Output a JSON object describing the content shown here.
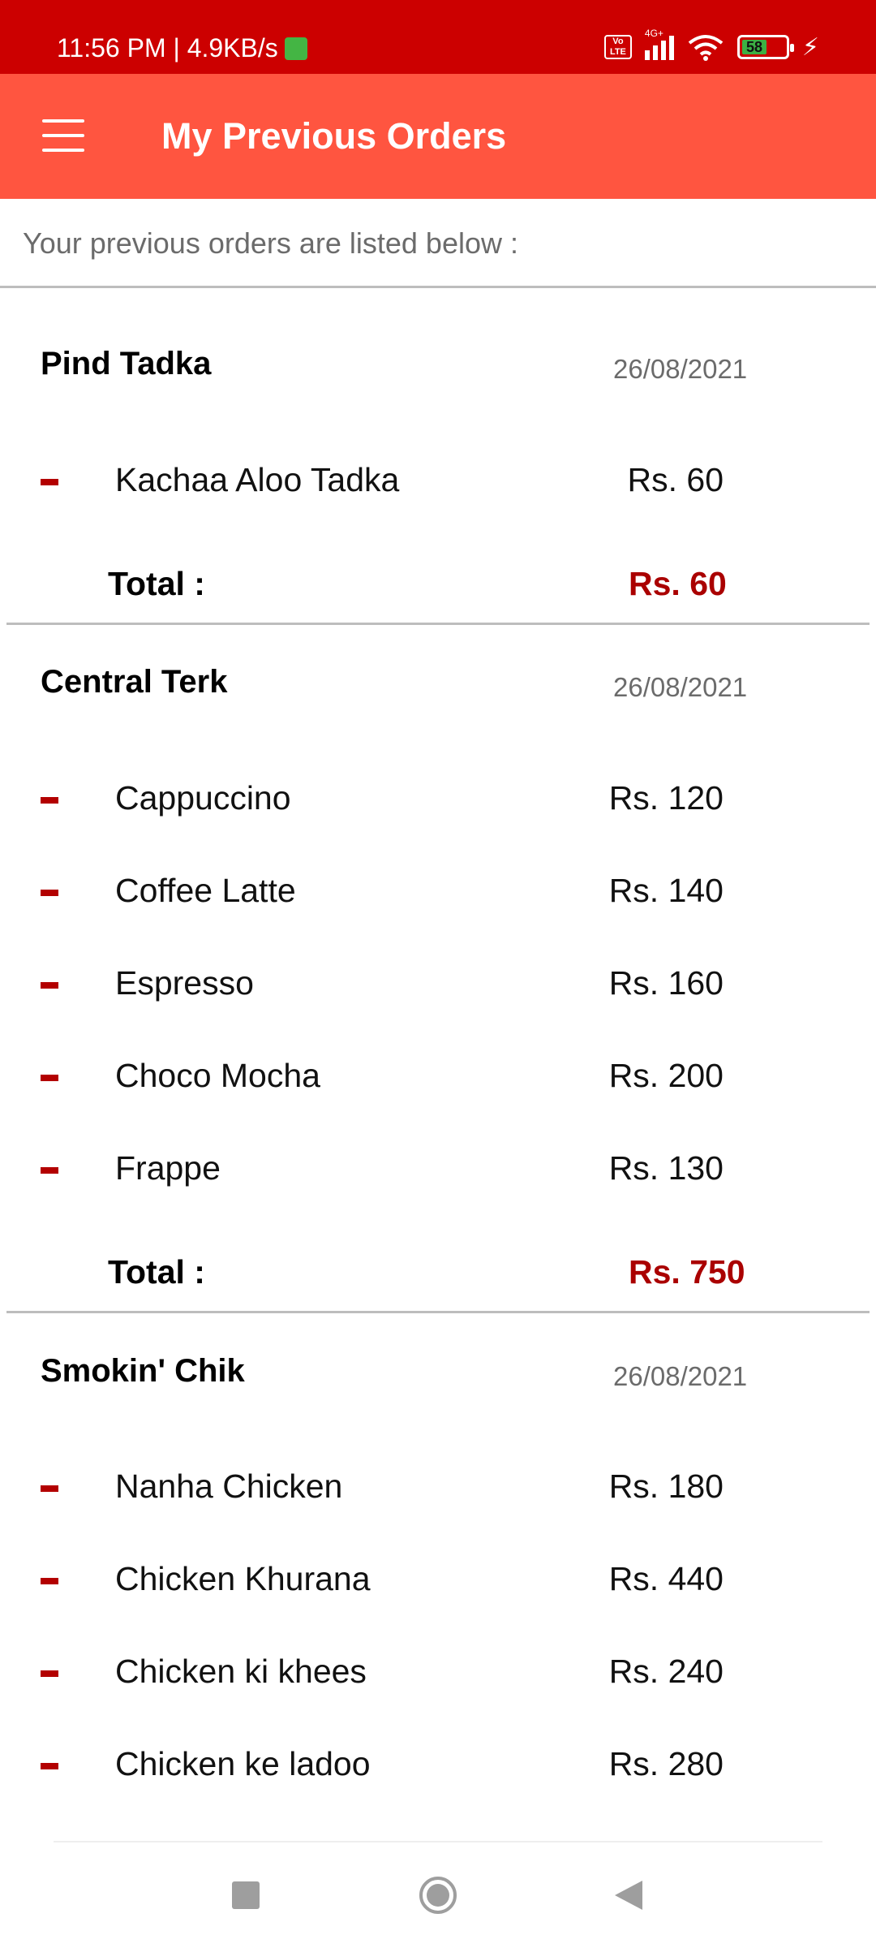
{
  "status_bar": {
    "time": "11:56 PM | 4.9KB/s",
    "volte": "Vo LTE",
    "network": "4G+",
    "battery": "58"
  },
  "app_bar": {
    "title": "My Previous Orders",
    "menu_icon": "hamburger-menu-icon"
  },
  "intro_text": "Your previous orders are listed below :",
  "orders": [
    {
      "restaurant": "Pind Tadka",
      "date": "26/08/2021",
      "items": [
        {
          "name": "Kachaa Aloo Tadka",
          "price": "Rs. 60"
        }
      ],
      "total_label": "Total :",
      "total": "Rs. 60"
    },
    {
      "restaurant": "Central Terk",
      "date": "26/08/2021",
      "items": [
        {
          "name": "Cappuccino",
          "price": "Rs. 120"
        },
        {
          "name": "Coffee Latte",
          "price": "Rs. 140"
        },
        {
          "name": "Espresso",
          "price": "Rs. 160"
        },
        {
          "name": "Choco Mocha",
          "price": "Rs. 200"
        },
        {
          "name": "Frappe",
          "price": "Rs. 130"
        }
      ],
      "total_label": "Total :",
      "total": "Rs. 750"
    },
    {
      "restaurant": "Smokin' Chik",
      "date": "26/08/2021",
      "items": [
        {
          "name": "Nanha Chicken",
          "price": "Rs. 180"
        },
        {
          "name": "Chicken Khurana",
          "price": "Rs. 440"
        },
        {
          "name": "Chicken ki khees",
          "price": "Rs. 240"
        },
        {
          "name": "Chicken ke ladoo",
          "price": "Rs. 280"
        }
      ]
    }
  ],
  "colors": {
    "status_bar": "#cc0000",
    "app_bar": "#ff5540",
    "accent": "#aa0000"
  },
  "nav_icons": [
    "recents-square-icon",
    "home-circle-icon",
    "back-triangle-icon"
  ]
}
